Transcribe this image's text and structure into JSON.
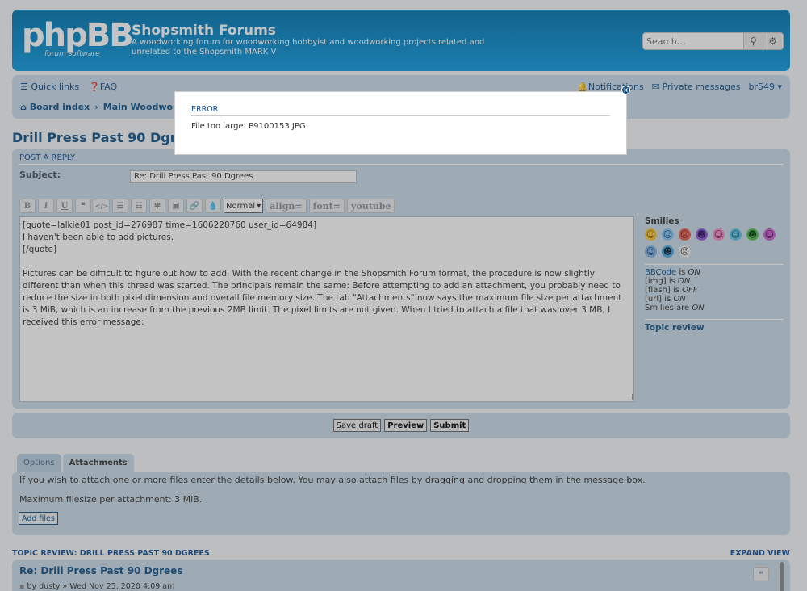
{
  "header": {
    "logo_text": "phpBB",
    "logo_sub": "forum software",
    "site_title": "Shopsmith Forums",
    "site_description": "A woodworking forum for woodworking hobbyist and woodworking projects related and unrelated to the Shopsmith MARK V",
    "search_placeholder": "Search…"
  },
  "nav": {
    "quick_links": "Quick links",
    "faq": "FAQ",
    "notifications": "Notifications",
    "private_messages": "Private messages",
    "username": "br549",
    "breadcrumb": [
      "Board index",
      "Main Woodworking"
    ]
  },
  "page_title": "Drill Press Past 90 Dgrees",
  "post_form": {
    "panel_title": "POST A REPLY",
    "subject_label": "Subject:",
    "subject_value": "Re: Drill Press Past 90 Dgrees",
    "font_size_select": "Normal",
    "toolbar_text_buttons": [
      "align=",
      "font=",
      "youtube"
    ],
    "message_lines": [
      "[quote=lalkie01 post_id=276987 time=1606228760 user_id=64984]",
      "I haven't been able to add pictures.",
      "[/quote]",
      "",
      "Pictures can be difficult to figure out how to add.  With the recent change in the Shopsmith Forum format, the procedure is now slightly different than when this thread was started.  The principals remain the same:  Before attempting to add an attachment, you probably need to reduce the size in both pixel dimension and overall file memory size.  The tab \"Attachments\" now says the maximum file size per attachment is 3 MiB, which is an increase from the previous 2MB limit.  The pixel limits are not given.  When I tried to attach a file that was over 3 MB, I received this error message:"
    ]
  },
  "sidebar": {
    "smilies_title": "Smilies",
    "bbcode_status": [
      {
        "label": "BBCode",
        "state": "ON"
      },
      {
        "label": "[img]",
        "state": "ON"
      },
      {
        "label": "[flash]",
        "state": "OFF"
      },
      {
        "label": "[url]",
        "state": "ON"
      },
      {
        "label": "Smilies are",
        "state": "ON"
      }
    ],
    "topic_review": "Topic review"
  },
  "buttons": {
    "save_draft": "Save draft",
    "preview": "Preview",
    "submit": "Submit"
  },
  "attachments": {
    "tab_options": "Options",
    "tab_attachments": "Attachments",
    "instructions": "If you wish to attach one or more files enter the details below. You may also attach files by dragging and dropping them in the message box.",
    "max_size": "Maximum filesize per attachment: 3 MiB.",
    "add_files": "Add files"
  },
  "topic_review": {
    "title": "TOPIC REVIEW: DRILL PRESS PAST 90 DGREES",
    "expand": "EXPAND VIEW",
    "post_title": "Re: Drill Press Past 90 Dgrees",
    "post_by": "by dusty » Wed Nov 25, 2020 4:09 am"
  },
  "modal": {
    "title": "ERROR",
    "message": "File too large: P9100153.JPG"
  },
  "colors": {
    "header_blue": "#12a3eb",
    "panel_bg": "#c9dbe8",
    "link_blue": "#105289"
  }
}
